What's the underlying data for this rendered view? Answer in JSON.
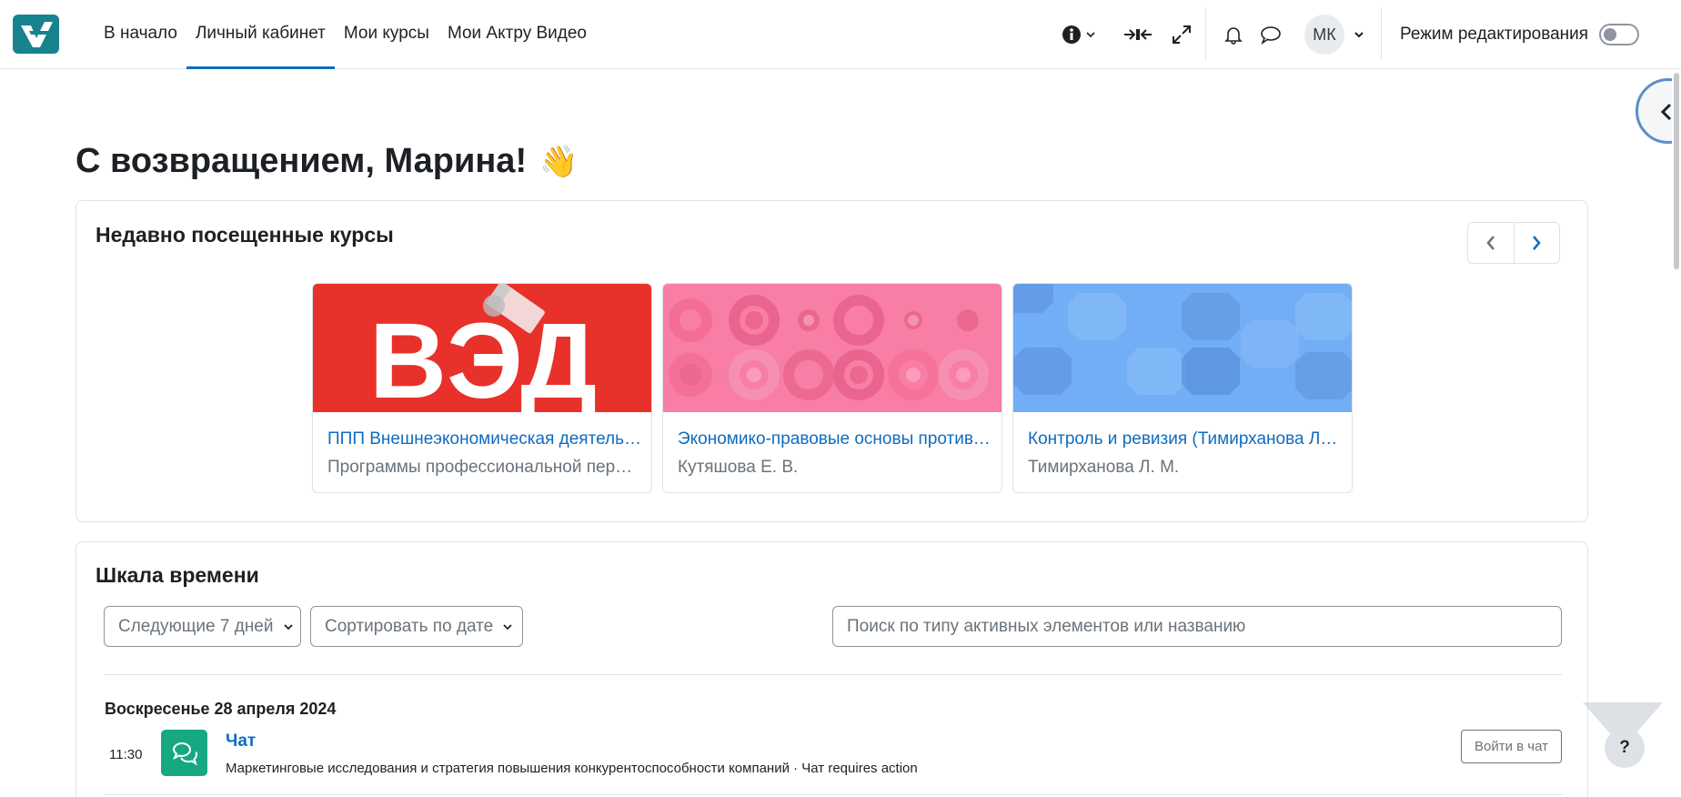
{
  "nav": {
    "logo_alt": "site-logo",
    "links": [
      {
        "label": "В начало"
      },
      {
        "label": "Личный кабинет"
      },
      {
        "label": "Мои курсы"
      },
      {
        "label": "Мои Актру Видео"
      }
    ],
    "avatar_initials": "МК",
    "edit_mode_label": "Режим редактирования",
    "edit_mode_on": false
  },
  "welcome": {
    "text": "С возвращением, Марина!",
    "emoji": "👋"
  },
  "recent_courses": {
    "title": "Недавно посещенные курсы",
    "courses": [
      {
        "name": "ППП Внешнеэкономическая деятельность",
        "category": "Программы профессиональной переподготовки",
        "image_text": "ВЭД",
        "image_color": "#e8312a"
      },
      {
        "name": "Экономико-правовые основы противодействия",
        "category": "Кутяшова Е. В.",
        "image_color": "#f87ea5"
      },
      {
        "name": "Контроль и ревизия (Тимирханова Л. М.)",
        "category": "Тимирханова Л. М.",
        "image_color": "#72aef5"
      }
    ]
  },
  "timeline": {
    "title": "Шкала времени",
    "filter_label": "Следующие 7 дней",
    "sort_label": "Сортировать по дате",
    "search_placeholder": "Поиск по типу активных элементов или названию",
    "date_heading": "Воскресенье 28 апреля 2024",
    "events": [
      {
        "time": "11:30",
        "title": "Чат",
        "description": "Маркетинговые исследования и стратегия повышения конкурентоспособности компаний · Чат requires action",
        "action_label": "Войти в чат"
      }
    ]
  },
  "help": {
    "label": "?"
  },
  "colors": {
    "primary": "#0f6cbf",
    "brand": "#17838e",
    "chat_icon": "#15a883"
  }
}
